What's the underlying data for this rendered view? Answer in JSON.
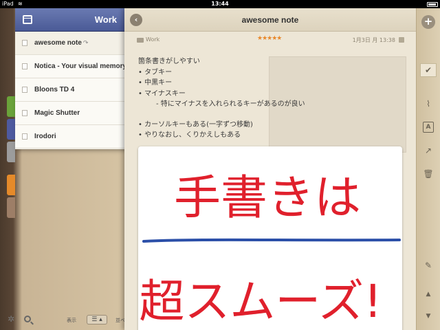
{
  "status_bar": {
    "carrier": "iPad",
    "time": "13:44"
  },
  "side_tab_colors": [
    "#6aa33a",
    "#4e5aa0",
    "#9c9c9c",
    "#e58a2a",
    "#9d7e67"
  ],
  "list_panel": {
    "title": "Work",
    "header_color": "#4a5a96",
    "items": [
      {
        "label": "awesome note",
        "link_icon": "↷",
        "selected": true
      },
      {
        "label": "Notica - Your visual memory"
      },
      {
        "label": "Bloons TD 4"
      },
      {
        "label": "Magic Shutter"
      },
      {
        "label": "Irodori"
      }
    ]
  },
  "bottom_toolbar": {
    "view_label": "表示",
    "view_toggle": "☰ ▴",
    "sort_label": "並べ"
  },
  "note": {
    "title": "awesome note",
    "folder": "Work",
    "rating_stars": "★★★★★",
    "rating": 5,
    "date": "1月3日 月 13:38",
    "lines": [
      "箇条書きがしやすい",
      "• タブキー",
      "• 中黒キー",
      "• マイナスキー"
    ],
    "indented_line": "- 特にマイナスを入れられるキーがあるのが良い",
    "lines2": [
      "• カーソルキーもある(一字ずつ移動)",
      "• やりなおし、くりかえしもある"
    ],
    "handwriting_line1": "手書きは",
    "handwriting_line2": "超スムーズ!",
    "ink_color": "#e0202c",
    "underline_color": "#2b4fa8"
  },
  "right_toolbar": {
    "add": "+",
    "check": "✔",
    "attach": "⌇",
    "font": "A",
    "share": "↗",
    "trash": "🗑",
    "pen": "✎",
    "up": "▲",
    "down": "▼"
  }
}
